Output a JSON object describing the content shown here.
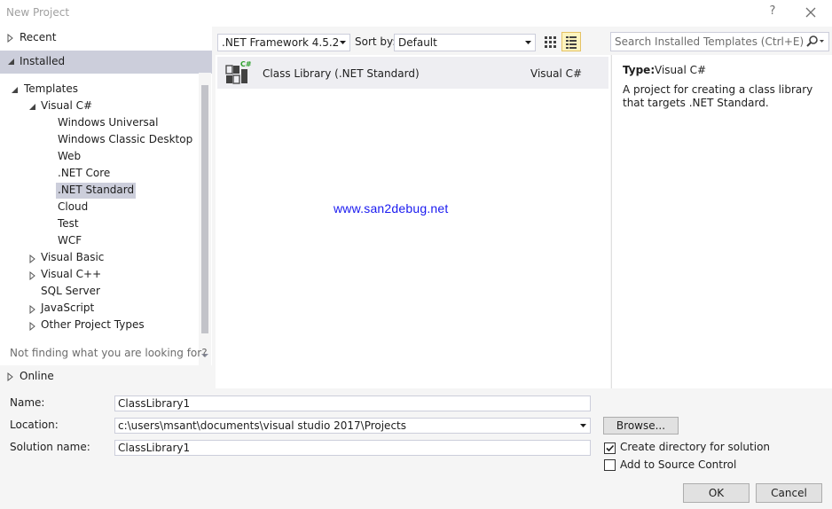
{
  "window": {
    "title": "New Project",
    "help": "?"
  },
  "tree": {
    "recent": "Recent",
    "installed": "Installed",
    "items": [
      {
        "label": "Templates",
        "level": 0,
        "expanded": true
      },
      {
        "label": "Visual C#",
        "level": 1,
        "expanded": true
      },
      {
        "label": "Windows Universal",
        "level": 2
      },
      {
        "label": "Windows Classic Desktop",
        "level": 2
      },
      {
        "label": "Web",
        "level": 2
      },
      {
        "label": ".NET Core",
        "level": 2
      },
      {
        "label": ".NET Standard",
        "level": 2,
        "selected": true
      },
      {
        "label": "Cloud",
        "level": 2
      },
      {
        "label": "Test",
        "level": 2
      },
      {
        "label": "WCF",
        "level": 2
      },
      {
        "label": "Visual Basic",
        "level": 1,
        "expanded": false
      },
      {
        "label": "Visual C++",
        "level": 1,
        "expanded": false
      },
      {
        "label": "SQL Server",
        "level": 1
      },
      {
        "label": "JavaScript",
        "level": 1,
        "expanded": false
      },
      {
        "label": "Other Project Types",
        "level": 1,
        "expanded": false
      }
    ],
    "not_finding": "Not finding what you are looking for?",
    "online": "Online"
  },
  "toolbar": {
    "framework": ".NET Framework 4.5.2",
    "sortby_label": "Sort by:",
    "sortby_value": "Default",
    "search_placeholder": "Search Installed Templates (Ctrl+E)"
  },
  "templates": [
    {
      "name": "Class Library (.NET Standard)",
      "language": "Visual C#",
      "icon": "class-library-icon"
    }
  ],
  "watermark": "www.san2debug.net",
  "details": {
    "type_label": "Type:",
    "type_value": "Visual C#",
    "description": "A project for creating a class library that targets .NET Standard."
  },
  "form": {
    "name_label": "Name:",
    "name_value": "ClassLibrary1",
    "location_label": "Location:",
    "location_value": "c:\\users\\msant\\documents\\visual studio 2017\\Projects",
    "solution_label": "Solution name:",
    "solution_value": "ClassLibrary1",
    "browse": "Browse...",
    "create_dir": "Create directory for solution",
    "create_dir_checked": true,
    "source_control": "Add to Source Control",
    "source_control_checked": false,
    "ok": "OK",
    "cancel": "Cancel"
  },
  "colors": {
    "selection": "#cccedb",
    "accent_watermark": "#1a1af0",
    "icon_green": "#2ca02c"
  }
}
